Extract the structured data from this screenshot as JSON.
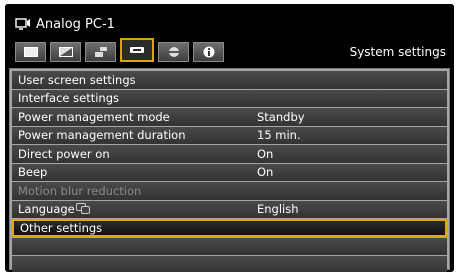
{
  "header": {
    "source_icon": "input-source-icon",
    "source_name": "Analog PC-1",
    "tab_title": "System settings"
  },
  "tabs": [
    {
      "icon": "picture-icon",
      "active": false
    },
    {
      "icon": "image-adjust-icon",
      "active": false
    },
    {
      "icon": "installation-icon",
      "active": false
    },
    {
      "icon": "system-settings-icon",
      "active": true
    },
    {
      "icon": "network-icon",
      "active": false
    },
    {
      "icon": "info-icon",
      "active": false
    }
  ],
  "menu": {
    "rows": [
      {
        "label": "User screen settings",
        "value": ""
      },
      {
        "label": "Interface settings",
        "value": ""
      },
      {
        "label": "Power management mode",
        "value": "Standby"
      },
      {
        "label": "Power management duration",
        "value": "15 min."
      },
      {
        "label": "Direct power on",
        "value": "On"
      },
      {
        "label": "Beep",
        "value": "On"
      },
      {
        "label": "Motion blur reduction",
        "value": "",
        "disabled": true
      },
      {
        "label": "Language",
        "value": "English",
        "icon": "language-icon"
      },
      {
        "label": "Other settings",
        "value": "",
        "selected": true
      }
    ]
  },
  "colors": {
    "selection_border": "#e0a800",
    "menu_background": "#a5a5a5",
    "disabled_text": "#8a8a8a"
  }
}
